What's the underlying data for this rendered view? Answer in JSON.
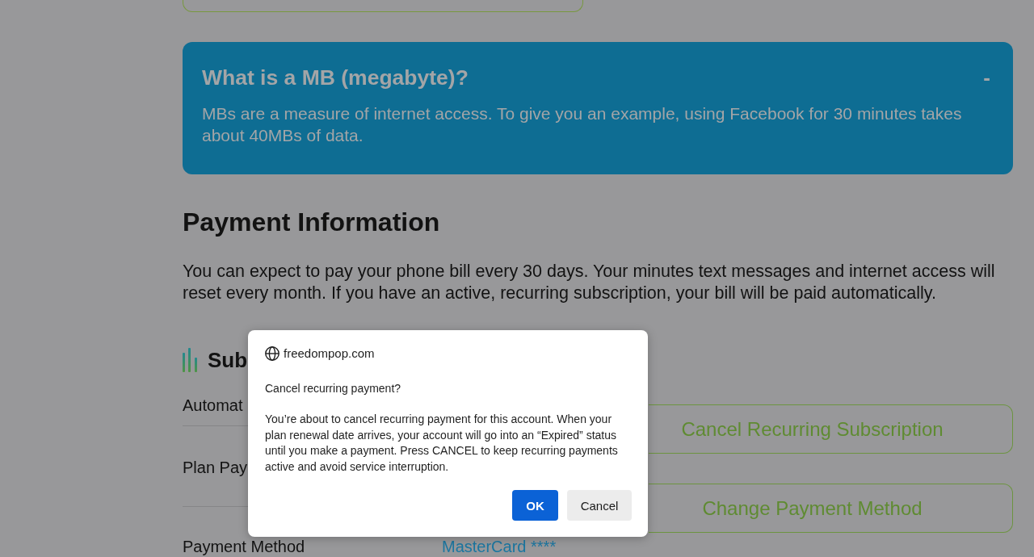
{
  "faq": {
    "title": "What is a MB (megabyte)?",
    "toggle": "-",
    "expanded": true,
    "answer": "MBs are a measure of internet access. To give you an example, using Facebook for 30 minutes takes about 40MBs of data."
  },
  "payment_info": {
    "heading": "Payment Information",
    "text": "You can expect to pay your phone bill every 30 days. Your minutes text messages and internet access will reset every month. If you have an active, recurring subscription, your bill will be paid automatically."
  },
  "subscription": {
    "heading": "Sub",
    "rows": [
      {
        "label": "Automat"
      },
      {
        "label": "Plan Pay"
      },
      {
        "label": "Payment Method",
        "value": "MasterCard ****"
      }
    ],
    "buttons": [
      "Cancel Recurring Subscription",
      "Change Payment Method"
    ]
  },
  "dialog": {
    "site": "freedompop.com",
    "title": "Cancel recurring payment?",
    "message": "You’re about to cancel recurring payment for this account. When your plan renewal date arrives, your account will go into an “Expired” status until you make a payment. Press CANCEL to keep recurring payments active and avoid service interruption.",
    "buttons": [
      {
        "label": "OK",
        "kind": "primary"
      },
      {
        "label": "Cancel",
        "kind": "secondary"
      }
    ]
  }
}
